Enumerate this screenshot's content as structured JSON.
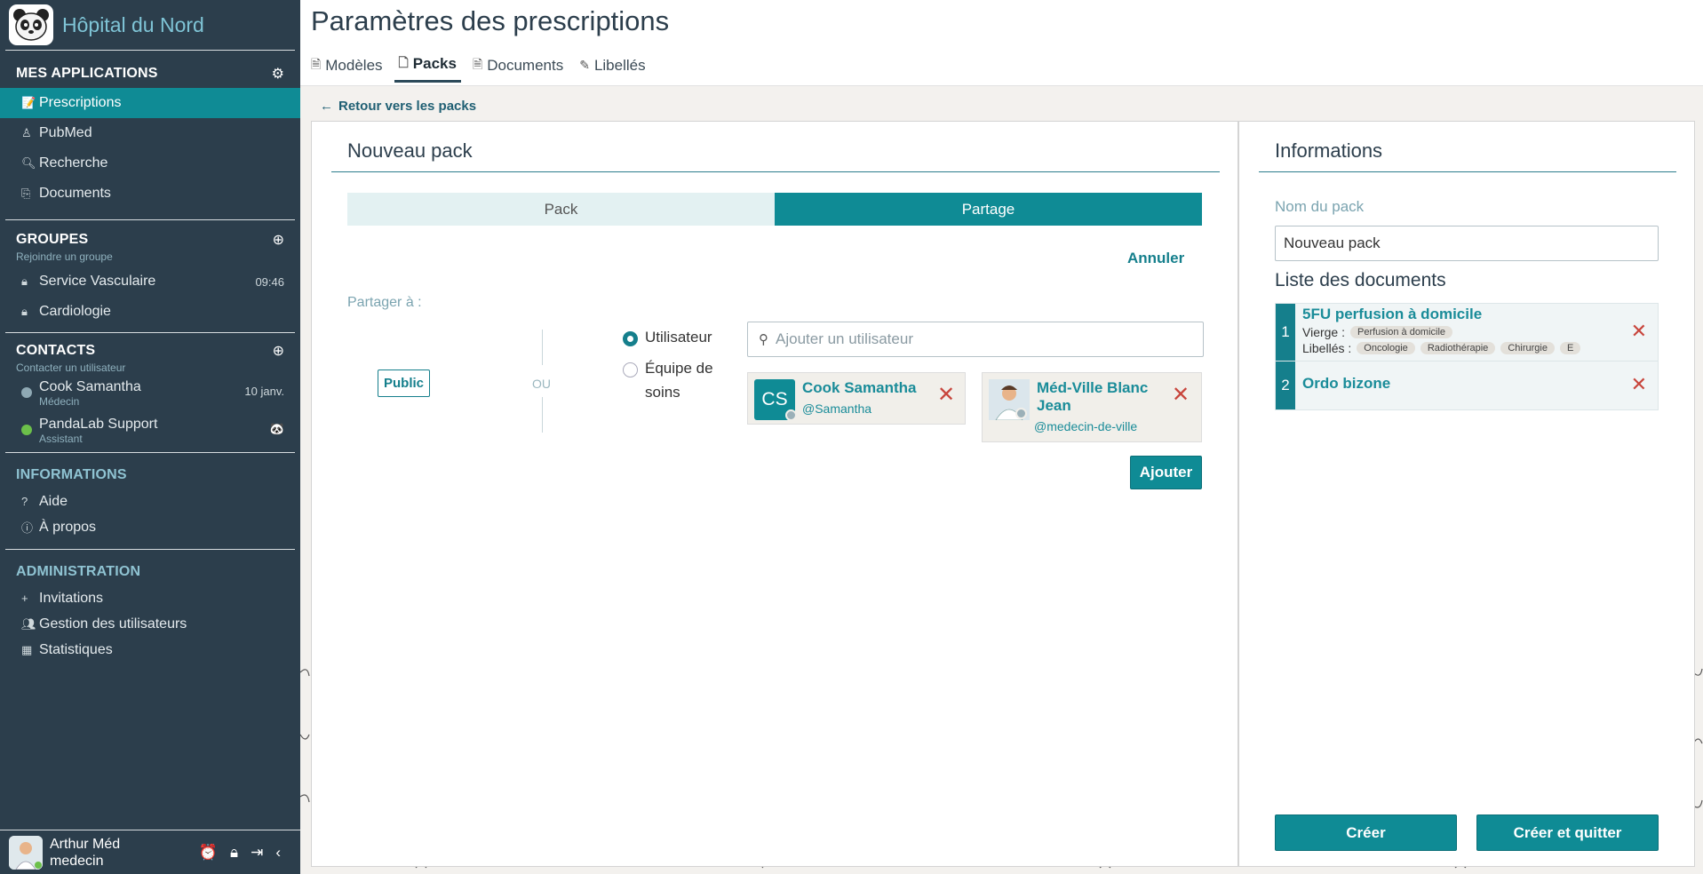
{
  "app": {
    "title": "Hôpital du Nord"
  },
  "sidebar": {
    "apps_title": "MES APPLICATIONS",
    "apps": [
      {
        "label": "Prescriptions",
        "icon": "prescription-icon"
      },
      {
        "label": "PubMed",
        "icon": "pubmed-icon"
      },
      {
        "label": "Recherche",
        "icon": "search-icon"
      },
      {
        "label": "Documents",
        "icon": "paperclip-icon"
      }
    ],
    "groups_title": "GROUPES",
    "groups_sub": "Rejoindre un groupe",
    "groups": [
      {
        "label": "Service Vasculaire",
        "time": "09:46"
      },
      {
        "label": "Cardiologie",
        "time": ""
      }
    ],
    "contacts_title": "CONTACTS",
    "contacts_sub": "Contacter un utilisateur",
    "contacts": [
      {
        "name": "Cook Samantha",
        "role": "Médecin",
        "time": "10 janv.",
        "status_color": "#8fa9b4"
      },
      {
        "name": "PandaLab Support",
        "role": "Assistant",
        "time": "",
        "status_color": "#6cc04a"
      }
    ],
    "info_title": "INFORMATIONS",
    "info": [
      {
        "label": "Aide",
        "icon": "question-icon"
      },
      {
        "label": "À propos",
        "icon": "info-icon"
      }
    ],
    "admin_title": "ADMINISTRATION",
    "admin": [
      {
        "label": "Invitations",
        "icon": "plus-icon"
      },
      {
        "label": "Gestion des utilisateurs",
        "icon": "users-icon"
      },
      {
        "label": "Statistiques",
        "icon": "stats-icon"
      }
    ],
    "user": {
      "name": "Arthur Méd",
      "role": "medecin"
    }
  },
  "header": {
    "title": "Paramètres des prescriptions",
    "tabs": [
      "Modèles",
      "Packs",
      "Documents",
      "Libellés"
    ],
    "active_tab": "Packs"
  },
  "back_link": "Retour vers les packs",
  "pack": {
    "title": "Nouveau pack",
    "segments": [
      "Pack",
      "Partage"
    ],
    "active_segment": "Partage",
    "cancel": "Annuler",
    "share_label": "Partager à :",
    "public_label": "Public",
    "or_label": "OU",
    "radio_user": "Utilisateur",
    "radio_team": "Équipe de soins",
    "search_placeholder": "Ajouter un utilisateur",
    "shared_users": [
      {
        "name": "Cook Samantha",
        "initials": "CS",
        "handle": "@Samantha"
      },
      {
        "name": "Méd-Ville Blanc Jean",
        "initials": "",
        "handle": "@medecin-de-ville"
      }
    ],
    "add_button": "Ajouter"
  },
  "info": {
    "title": "Informations",
    "name_label": "Nom du pack",
    "name_value": "Nouveau pack",
    "list_title": "Liste des documents",
    "documents": [
      {
        "index": "1",
        "title": "5FU perfusion à domicile",
        "vierge_label": "Vierge :",
        "vierge": [
          "Perfusion à domicile"
        ],
        "labels_label": "Libellés :",
        "labels": [
          "Oncologie",
          "Radiothérapie",
          "Chirurgie",
          "E"
        ]
      },
      {
        "index": "2",
        "title": "Ordo bizone"
      }
    ],
    "create": "Créer",
    "create_quit": "Créer et quitter"
  },
  "colors": {
    "accent": "#0f8b95",
    "sidebar": "#2c3e4c",
    "danger": "#c8453c"
  }
}
